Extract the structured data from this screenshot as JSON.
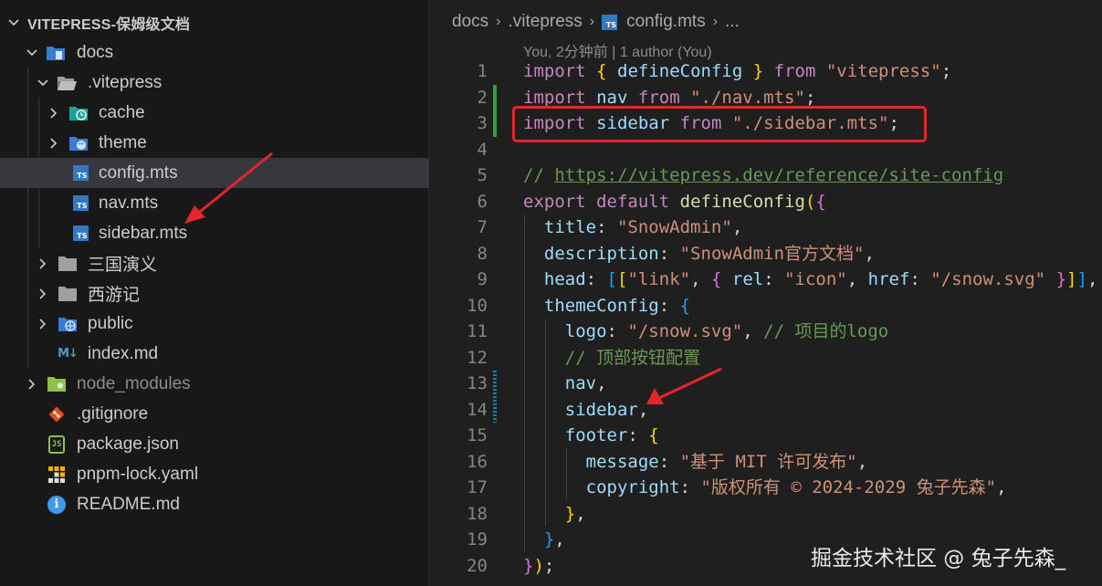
{
  "explorer": {
    "root_label": "VITEPRESS-保姆级文档",
    "items": [
      {
        "label": "docs",
        "icon": "folder-docs-icon"
      },
      {
        "label": ".vitepress",
        "icon": "folder-open-icon"
      },
      {
        "label": "cache",
        "icon": "folder-cache-icon"
      },
      {
        "label": "theme",
        "icon": "folder-theme-icon"
      },
      {
        "label": "config.mts",
        "icon": "typescript-file-icon"
      },
      {
        "label": "nav.mts",
        "icon": "typescript-file-icon"
      },
      {
        "label": "sidebar.mts",
        "icon": "typescript-file-icon"
      },
      {
        "label": "三国演义",
        "icon": "folder-icon"
      },
      {
        "label": "西游记",
        "icon": "folder-icon"
      },
      {
        "label": "public",
        "icon": "folder-public-icon"
      },
      {
        "label": "index.md",
        "icon": "markdown-file-icon"
      },
      {
        "label": "node_modules",
        "icon": "folder-node-icon"
      },
      {
        "label": ".gitignore",
        "icon": "git-file-icon"
      },
      {
        "label": "package.json",
        "icon": "json-file-icon"
      },
      {
        "label": "pnpm-lock.yaml",
        "icon": "pnpm-file-icon"
      },
      {
        "label": "README.md",
        "icon": "info-file-icon"
      }
    ]
  },
  "editor": {
    "breadcrumb": [
      "docs",
      ".vitepress",
      "config.mts",
      "..."
    ],
    "ts_badge": "TS",
    "blame": "You, 2分钟前 | 1 author (You)",
    "code": {
      "l5_comment": "// ",
      "l5_url": "https://vitepress.dev/reference/site-config",
      "title": "\"SnowAdmin\"",
      "description": "\"SnowAdmin官方文档\"",
      "head_link": "\"link\"",
      "head_rel": "\"icon\"",
      "head_href": "\"/snow.svg\"",
      "logo": "\"/snow.svg\"",
      "logo_comment": "// 项目的logo",
      "nav_comment": "// 顶部按钮配置",
      "message": "\"基于 MIT 许可发布\"",
      "copyright": "\"版权所有 © 2024-2029 兔子先森\""
    }
  },
  "watermark": "掘金技术社区 @ 兔子先森_",
  "colors": {
    "highlight_box": "#e3262c",
    "annotation_arrow": "#e3262c",
    "active_row": "#37373d",
    "git_added": "#2ea043"
  }
}
